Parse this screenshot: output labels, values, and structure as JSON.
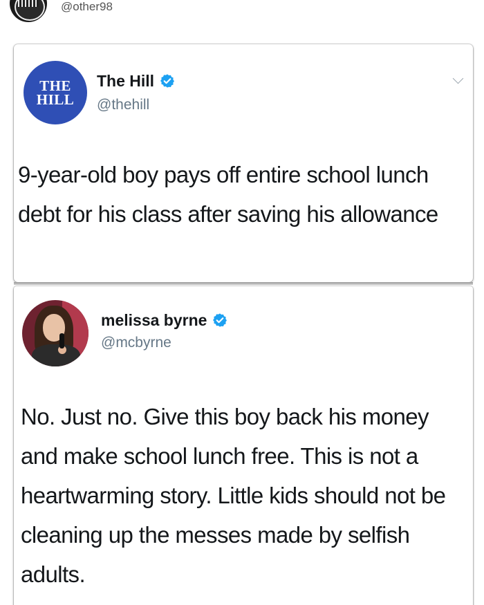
{
  "repost": {
    "handle": "@other98"
  },
  "tweets": [
    {
      "author_name": "The Hill",
      "author_handle": "@thehill",
      "avatar_logo": "THE\nHILL",
      "verified": true,
      "text": "9-year-old boy pays off entire school lunch debt for his class after saving his allowance"
    },
    {
      "author_name": "melissa byrne",
      "author_handle": "@mcbyrne",
      "verified": true,
      "text": "No. Just no. Give this boy back his money and make school lunch free. This is not a heartwarming story. Little kids should not be cleaning up the messes made by selfish adults."
    }
  ],
  "colors": {
    "verified_blue": "#1da1f2",
    "hill_blue": "#2f4fb5",
    "handle_gray": "#657786"
  },
  "icons": {
    "verified": "verified-badge-icon",
    "chevron": "chevron-down-icon"
  }
}
